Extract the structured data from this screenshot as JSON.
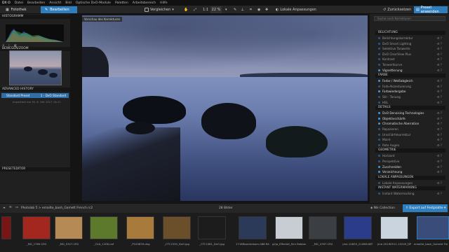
{
  "menu": {
    "logo": "DX O",
    "items": [
      "Datei",
      "Bearbeiten",
      "Ansicht",
      "Bild",
      "Optische DxO-Module",
      "Paletten",
      "Arbeitsbereich",
      "Hilfe"
    ]
  },
  "toolbar": {
    "tab_fotothek": "Fotothek",
    "tab_bearbeiten": "Bearbeiten",
    "compare": "Vergleichen",
    "ratio": "1:1",
    "zoom": "22 %",
    "local_adjust": "Lokale Anpassungen",
    "reset": "Zurücksetzen",
    "apply_preset": "Preset anwenden"
  },
  "left": {
    "histogram": "HISTOGRAMM",
    "navigator": "BEWEGEN/ZOOM",
    "history": "ADVANCED HISTORY",
    "history_item": "Standard Preset",
    "history_item_right": "1 - DxO Standard",
    "history_date": "Importiert am Mi. 8. Okt 2017 18:11",
    "presets": "PRESETEDITOR"
  },
  "viewer": {
    "label": "Vorschau des Korrekturen"
  },
  "right": {
    "search": "Suche nach Korrekturen",
    "sections": [
      {
        "title": "BELICHTUNG",
        "items": [
          {
            "label": "Belichtungskorrektur",
            "on": false
          },
          {
            "label": "DxO Smart Lighting",
            "on": false
          },
          {
            "label": "Selektive Tonwerte",
            "on": false
          },
          {
            "label": "DxO ClearView Plus",
            "on": false
          },
          {
            "label": "Kontrast",
            "on": false
          },
          {
            "label": "Tonwertkurve",
            "on": false
          },
          {
            "label": "Vignettierung",
            "on": true
          }
        ]
      },
      {
        "title": "FARBE",
        "items": [
          {
            "label": "Farbe / Weißabgleich",
            "on": true
          },
          {
            "label": "Farb-Akzentuierung",
            "on": false
          },
          {
            "label": "Farbwiedergabe",
            "on": true
          },
          {
            "label": "Stil - Tonung",
            "on": false
          },
          {
            "label": "HSL",
            "on": false
          }
        ]
      },
      {
        "title": "DETAILS",
        "items": [
          {
            "label": "DxO Denoising Technologies",
            "on": true
          },
          {
            "label": "Objektivschärfe",
            "on": true
          },
          {
            "label": "Chromatische Aberration",
            "on": true
          },
          {
            "label": "Reparieren",
            "on": false
          },
          {
            "label": "Unschärfekorrektur",
            "on": false
          },
          {
            "label": "Moiré",
            "on": false
          },
          {
            "label": "Rote Augen",
            "on": false
          }
        ]
      },
      {
        "title": "GEOMETRIE",
        "items": [
          {
            "label": "Horizont",
            "on": false
          },
          {
            "label": "Perspektive",
            "on": false
          },
          {
            "label": "Zuschneiden",
            "on": true
          },
          {
            "label": "Verzeichnung",
            "on": true
          }
        ]
      },
      {
        "title": "LOKALE ANPASSUNGEN",
        "items": [
          {
            "label": "Lokale Anpassungen",
            "on": false
          }
        ]
      },
      {
        "title": "INSTANT WATERMARKING",
        "items": [
          {
            "label": "Instant Watermarking",
            "on": false
          }
        ]
      }
    ]
  },
  "filmbar": {
    "path": "Photolab 5 > emailte_bash_Gamett French.rc2",
    "count": "28 Bilder",
    "collection": "Nik Collection",
    "export": "Export auf Festplatte"
  },
  "thumbs": [
    {
      "name": "",
      "color": "#7a1515"
    },
    {
      "name": "_MG_1789.CR2",
      "color": "#a3261f"
    },
    {
      "name": "_MG_5327.CR2",
      "color": "#b58a54"
    },
    {
      "name": "_OLA_1206.nef",
      "color": "#5d7a2c"
    },
    {
      "name": "_P105839.dng",
      "color": "#a87a3b"
    },
    {
      "name": "_CTC1530_DxO.jpg",
      "color": "#6b4f2a"
    },
    {
      "name": "_CTC1581_DxO.jpg",
      "color": "#1c1c1c"
    },
    {
      "name": "1718Rosenbloom-086.RAF",
      "color": "#2c3a5a"
    },
    {
      "name": "g2ja_Effectet_Sim Rebbeca.ORF",
      "color": "#c8ccd3"
    },
    {
      "name": "_MG_4787.CR2",
      "color": "#3b3f44"
    },
    {
      "name": "jme-14829_21068.NEF",
      "color": "#2b3d8a"
    },
    {
      "name": "jme-20190511-15249_DPV.ORF",
      "color": "#c9d4df"
    },
    {
      "name": "emailte_bash_Gamett French",
      "color": "#3a4c79"
    }
  ]
}
